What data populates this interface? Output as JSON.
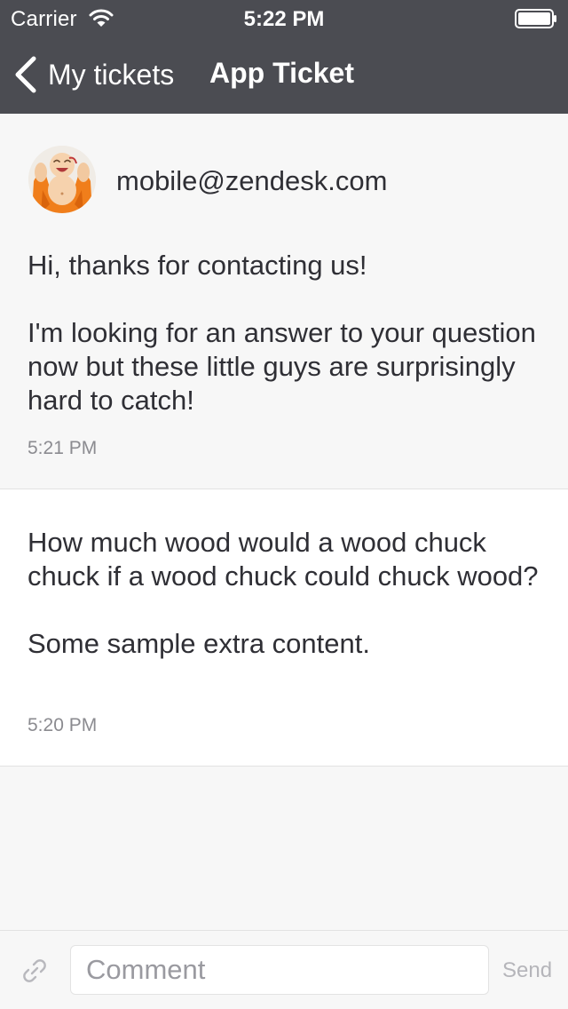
{
  "status_bar": {
    "carrier": "Carrier",
    "time": "5:22 PM",
    "icons": [
      "wifi-icon",
      "battery-icon"
    ]
  },
  "nav": {
    "back_label": "My tickets",
    "title": "App Ticket",
    "back_icon": "chevron-left-icon"
  },
  "messages": [
    {
      "author": "mobile@zendesk.com",
      "avatar_icon": "laughing-buddha-avatar",
      "paragraphs": [
        "Hi, thanks for contacting us!",
        "I'm looking for an answer to your question now but these little guys are surprisingly hard to catch!"
      ],
      "time": "5:21 PM"
    },
    {
      "paragraphs": [
        "How much wood would a wood chuck chuck if a wood chuck could chuck wood?",
        "Some sample extra content."
      ],
      "time": "5:20 PM"
    }
  ],
  "composer": {
    "placeholder": "Comment",
    "value": "",
    "send_label": "Send",
    "attach_icon": "paperclip-icon"
  },
  "colors": {
    "nav_background": "#4b4c52",
    "page_background": "#f7f7f7",
    "text": "#2f2f35",
    "timestamp": "#8b8b90",
    "send_disabled": "#b5b5ba",
    "avatar_robe": "#f07e1b"
  }
}
